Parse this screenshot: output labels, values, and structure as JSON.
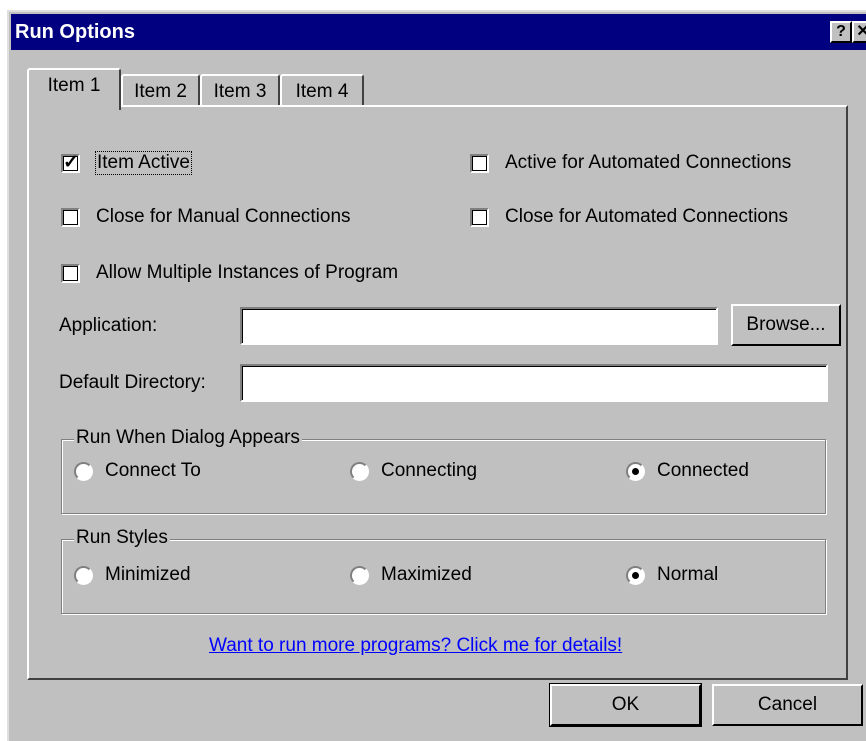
{
  "window": {
    "title": "Run Options",
    "help_glyph": "?",
    "close_glyph": "✕"
  },
  "tabs": [
    {
      "label": "Item 1",
      "active": true
    },
    {
      "label": "Item 2",
      "active": false
    },
    {
      "label": "Item 3",
      "active": false
    },
    {
      "label": "Item 4",
      "active": false
    }
  ],
  "checkboxes": {
    "item_active": {
      "label": "Item Active",
      "checked": true
    },
    "active_automated": {
      "label": "Active for Automated Connections",
      "checked": false
    },
    "close_manual": {
      "label": "Close for Manual Connections",
      "checked": false
    },
    "close_automated": {
      "label": "Close for Automated Connections",
      "checked": false
    },
    "allow_multiple": {
      "label": "Allow Multiple Instances of Program",
      "checked": false
    }
  },
  "check_glyph": "✓",
  "application": {
    "label": "Application:",
    "value": "",
    "browse_label": "Browse..."
  },
  "default_directory": {
    "label": "Default Directory:",
    "value": ""
  },
  "run_when": {
    "legend": "Run When Dialog Appears",
    "options": [
      {
        "label": "Connect To",
        "selected": false
      },
      {
        "label": "Connecting",
        "selected": false
      },
      {
        "label": "Connected",
        "selected": true
      }
    ]
  },
  "run_styles": {
    "legend": "Run Styles",
    "options": [
      {
        "label": "Minimized",
        "selected": false
      },
      {
        "label": "Maximized",
        "selected": false
      },
      {
        "label": "Normal",
        "selected": true
      }
    ]
  },
  "more_link": "Want to run more programs?  Click me for details!",
  "buttons": {
    "ok": "OK",
    "cancel": "Cancel"
  }
}
